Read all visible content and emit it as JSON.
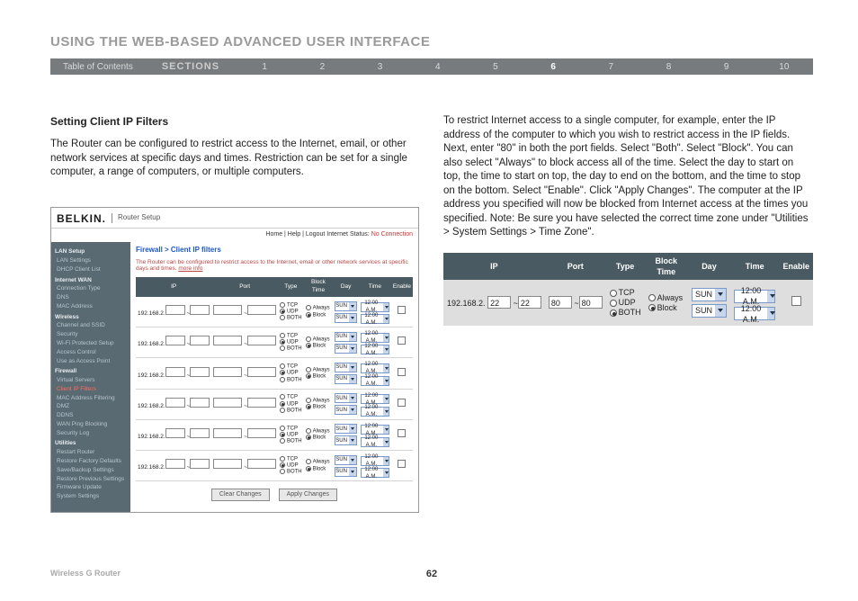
{
  "header": {
    "title": "USING THE WEB-BASED ADVANCED USER INTERFACE",
    "toc": "Table of Contents",
    "sections_label": "SECTIONS",
    "nums": [
      "1",
      "2",
      "3",
      "4",
      "5",
      "6",
      "7",
      "8",
      "9",
      "10"
    ],
    "active_index": 5
  },
  "left": {
    "subhead": "Setting Client IP Filters",
    "para": "The Router can be configured to restrict access to the Internet, email, or other network services at specific days and times. Restriction can be set for a single computer, a range of computers, or multiple computers."
  },
  "right": {
    "para": "To restrict Internet access to a single computer, for example, enter the IP address of the computer to which you wish to restrict access in the IP fields. Next, enter \"80\" in both the port fields. Select \"Both\". Select \"Block\". You can also select \"Always\" to block access all of the time. Select the day to start on top, the time to start on top, the day to end on the bottom, and the time to stop on the bottom. Select \"Enable\". Click \"Apply Changes\". The computer at the IP address you specified will now be blocked from Internet access at the times you specified. Note: Be sure you have selected the correct time zone under \"Utilities > System Settings > Time Zone\"."
  },
  "router": {
    "brand": "BELKIN.",
    "brand_sub": "Router Setup",
    "topbar": {
      "links": "Home | Help | Logout  Internet Status:",
      "status": "No Connection"
    },
    "sidebar": {
      "groups": [
        {
          "label": "LAN Setup",
          "items": [
            "LAN Settings",
            "DHCP Client List"
          ]
        },
        {
          "label": "Internet WAN",
          "items": [
            "Connection Type",
            "DNS",
            "MAC Address"
          ]
        },
        {
          "label": "Wireless",
          "items": [
            "Channel and SSID",
            "Security",
            "Wi-Fi Protected Setup",
            "Access Control",
            "Use as Access Point"
          ]
        },
        {
          "label": "Firewall",
          "items": [
            "Virtual Servers",
            "Client IP Filters",
            "MAC Address Filtering",
            "DMZ",
            "DDNS",
            "WAN Ping Blocking",
            "Security Log"
          ]
        },
        {
          "label": "Utilities",
          "items": [
            "Restart Router",
            "Restore Factory Defaults",
            "Save/Backup Settings",
            "Restore Previous Settings",
            "Firmware Update",
            "System Settings"
          ]
        }
      ],
      "active": "Client IP Filters"
    },
    "breadcrumb": "Firewall > Client IP filters",
    "desc": "The Router can be configured to restrict access to the Internet, email or other network services at specific days and times.",
    "more": "more info",
    "table": {
      "headers": [
        "IP",
        "Port",
        "Type",
        "Block Time",
        "Day",
        "Time",
        "Enable"
      ],
      "type_opts": [
        "TCP",
        "UDP",
        "BOTH"
      ],
      "block_opts": [
        "Always",
        "Block"
      ],
      "rows": [
        {
          "ip": "192.168.2.",
          "day": "SUN",
          "time": "12:00 A.M."
        },
        {
          "ip": "192.168.2.",
          "day": "SUN",
          "time": "12:00 A.M."
        },
        {
          "ip": "192.168.2.",
          "day": "SUN",
          "time": "12:00 A.M."
        },
        {
          "ip": "192.168.2.",
          "day": "SUN",
          "time": "12:00 A.M."
        },
        {
          "ip": "192.168.2.",
          "day": "SUN",
          "time": "12:00 A.M."
        },
        {
          "ip": "192.168.2.",
          "day": "SUN",
          "time": "12:00 A.M."
        }
      ]
    },
    "buttons": {
      "clear": "Clear Changes",
      "apply": "Apply Changes"
    }
  },
  "big": {
    "headers": [
      "IP",
      "Port",
      "Type",
      "Block Time",
      "Day",
      "Time",
      "Enable"
    ],
    "row": {
      "ip_prefix": "192.168.2.",
      "ip_a": "22",
      "ip_b": "22",
      "port_a": "80",
      "port_b": "80",
      "type": [
        "TCP",
        "UDP",
        "BOTH"
      ],
      "type_sel": "BOTH",
      "block": [
        "Always",
        "Block"
      ],
      "block_sel": "Block",
      "day": "SUN",
      "time": "12:00 A.M."
    }
  },
  "footer": {
    "product": "Wireless G Router",
    "page": "62"
  }
}
